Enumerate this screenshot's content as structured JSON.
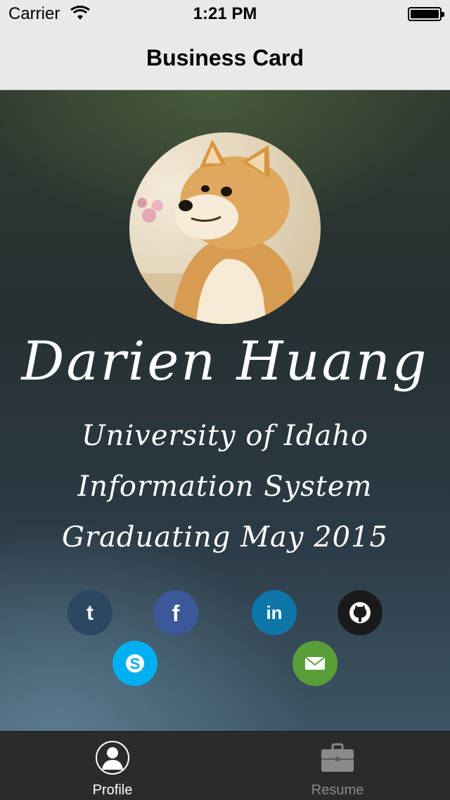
{
  "status_bar": {
    "carrier": "Carrier",
    "time": "1:21 PM"
  },
  "nav": {
    "title": "Business Card"
  },
  "profile": {
    "name": "Darien Huang",
    "school": "University of Idaho",
    "major": "Information System",
    "graduation": "Graduating May 2015"
  },
  "social": [
    {
      "icon": "tumblr-icon",
      "color": "#2c4762"
    },
    {
      "icon": "facebook-icon",
      "color": "#3b5998"
    },
    {
      "icon": "linkedin-icon",
      "color": "#0e76a8"
    },
    {
      "icon": "github-icon",
      "color": "#1a1a1a"
    },
    {
      "icon": "skype-icon",
      "color": "#00aff0"
    },
    {
      "icon": "email-icon",
      "color": "#5a9e3a"
    }
  ],
  "tabs": [
    {
      "label": "Profile",
      "icon": "person-icon",
      "active": true
    },
    {
      "label": "Resume",
      "icon": "briefcase-icon",
      "active": false
    }
  ]
}
